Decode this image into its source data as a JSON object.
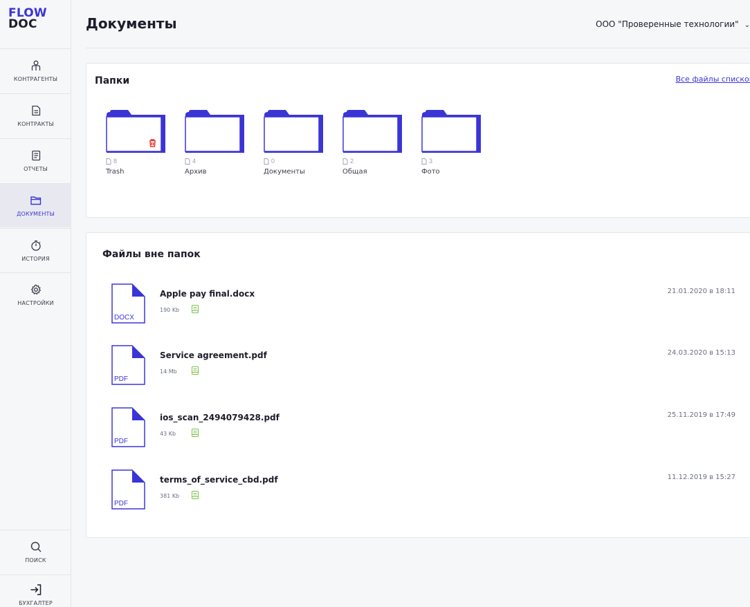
{
  "app": {
    "logo_line1": "FLOW",
    "logo_line2": "DOC",
    "accent_color": "#3b35d6"
  },
  "sidebar": {
    "items": [
      {
        "label": "КОНТРАГЕНТЫ",
        "icon": "user-icon"
      },
      {
        "label": "КОНТРАКТЫ",
        "icon": "contract-icon"
      },
      {
        "label": "ОТЧЕТЫ",
        "icon": "report-icon"
      },
      {
        "label": "ДОКУМЕНТЫ",
        "icon": "folder-icon",
        "active": true
      },
      {
        "label": "ИСТОРИЯ",
        "icon": "stopwatch-icon"
      },
      {
        "label": "НАСТРОЙКИ",
        "icon": "gear-icon"
      }
    ],
    "bottom": [
      {
        "label": "ПОИСК",
        "icon": "search-icon"
      },
      {
        "label": "БУХГАЛТЕР",
        "icon": "logout-icon"
      }
    ]
  },
  "header": {
    "title": "Документы",
    "org_name": "ООО \"Проверенные технологии\""
  },
  "folders_section": {
    "title": "Папки",
    "all_files_link": "Все файлы списком",
    "folders": [
      {
        "name": "Trash",
        "count": "8",
        "trash": true
      },
      {
        "name": "Архив",
        "count": "4"
      },
      {
        "name": "Документы",
        "count": "0"
      },
      {
        "name": "Общая",
        "count": "2"
      },
      {
        "name": "Фото",
        "count": "3"
      }
    ]
  },
  "files_section": {
    "title": "Файлы вне папок",
    "files": [
      {
        "name": "Apple pay final.docx",
        "type": "DOCX",
        "size": "190 Kb",
        "date": "21.01.2020 в 18:11"
      },
      {
        "name": "Service agreement.pdf",
        "type": "PDF",
        "size": "14 Mb",
        "date": "24.03.2020 в 15:13"
      },
      {
        "name": "ios_scan_2494079428.pdf",
        "type": "PDF",
        "size": "43 Kb",
        "date": "25.11.2019 в 17:49"
      },
      {
        "name": "terms_of_service_cbd.pdf",
        "type": "PDF",
        "size": "381 Kb",
        "date": "11.12.2019 в 15:27"
      }
    ]
  }
}
